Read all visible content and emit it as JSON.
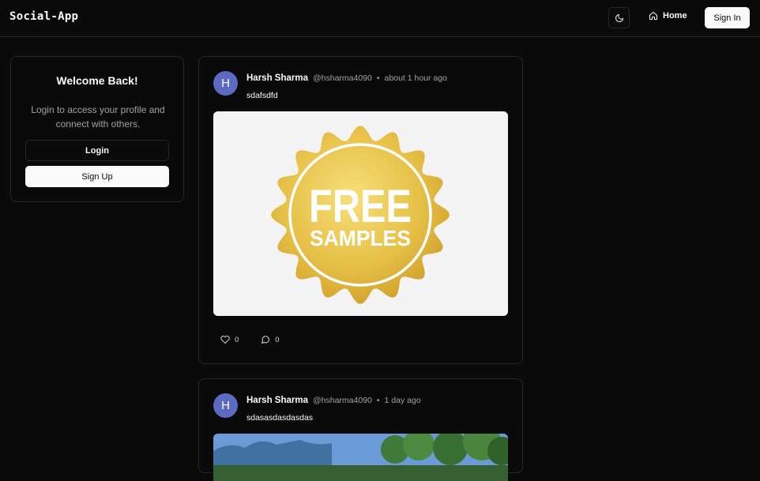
{
  "app": {
    "brand": "Social-App"
  },
  "nav": {
    "home_label": "Home",
    "signin_label": "Sign In",
    "theme_icon": "moon-icon",
    "home_icon": "home-icon"
  },
  "welcome": {
    "title": "Welcome Back!",
    "subtitle": "Login to access your profile and connect with others.",
    "login_label": "Login",
    "signup_label": "Sign Up"
  },
  "posts": [
    {
      "avatar_initial": "H",
      "author": "Harsh Sharma",
      "handle": "@hsharma4090",
      "separator": "•",
      "time": "about 1 hour ago",
      "text": "sdafsdfd",
      "image_badge_line1": "FREE",
      "image_badge_line2": "SAMPLES",
      "likes": "0",
      "comments": "0"
    },
    {
      "avatar_initial": "H",
      "author": "Harsh Sharma",
      "handle": "@hsharma4090",
      "separator": "•",
      "time": "1 day ago",
      "text": "sdasasdasdasdas"
    }
  ],
  "colors": {
    "background": "#0a0a0a",
    "border": "#262626",
    "muted_text": "#a1a1a1",
    "avatar": "#5c6bc0",
    "badge_gold": "#e2b93b"
  }
}
